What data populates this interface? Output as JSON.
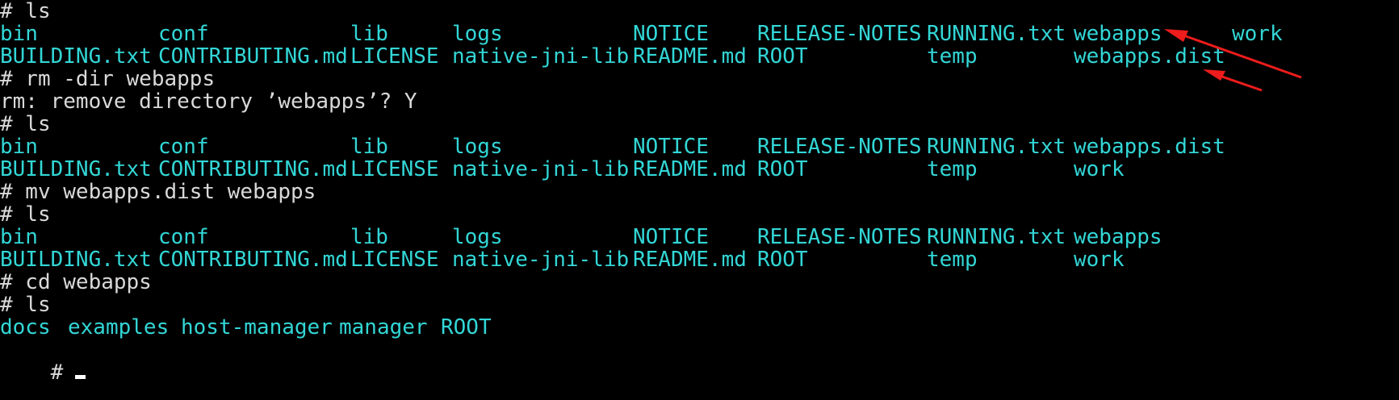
{
  "colors": {
    "background": "#000000",
    "text": "#d9d9d9",
    "listing": "#33d6d6",
    "arrow": "#ee1c1c",
    "cursor": "#ffffff"
  },
  "lines": {
    "l0": "# ls",
    "l3": "# rm -dir webapps",
    "l4": "rm: remove directory ’webapps’? Y",
    "l5": "# ls",
    "l8": "# mv webapps.dist webapps",
    "l9": "# ls",
    "l12": "# cd webapps",
    "l13": "# ls",
    "l15": "#"
  },
  "listing1": {
    "row1": [
      "bin",
      "conf",
      "lib",
      "logs",
      "NOTICE",
      "RELEASE-NOTES",
      "RUNNING.txt",
      "webapps",
      "work"
    ],
    "row2": [
      "BUILDING.txt",
      "CONTRIBUTING.md",
      "LICENSE",
      "native-jni-lib",
      "README.md",
      "ROOT",
      "temp",
      "webapps.dist"
    ]
  },
  "listing2": {
    "row1": [
      "bin",
      "conf",
      "lib",
      "logs",
      "NOTICE",
      "RELEASE-NOTES",
      "RUNNING.txt",
      "webapps.dist"
    ],
    "row2": [
      "BUILDING.txt",
      "CONTRIBUTING.md",
      "LICENSE",
      "native-jni-lib",
      "README.md",
      "ROOT",
      "temp",
      "work"
    ]
  },
  "listing3": {
    "row1": [
      "bin",
      "conf",
      "lib",
      "logs",
      "NOTICE",
      "RELEASE-NOTES",
      "RUNNING.txt",
      "webapps"
    ],
    "row2": [
      "BUILDING.txt",
      "CONTRIBUTING.md",
      "LICENSE",
      "native-jni-lib",
      "README.md",
      "ROOT",
      "temp",
      "work"
    ]
  },
  "listing4": {
    "row1": [
      "docs",
      "examples",
      "host-manager",
      "manager",
      "ROOT"
    ]
  },
  "annotation_icons": [
    "red-arrow-icon",
    "red-arrow-icon"
  ]
}
